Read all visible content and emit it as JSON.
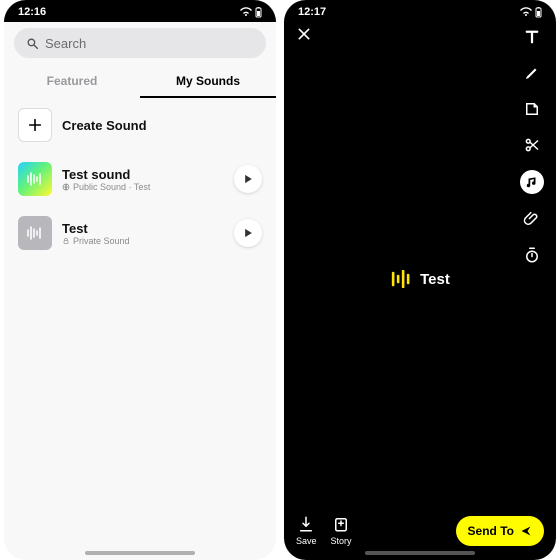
{
  "left": {
    "time": "12:16",
    "search_placeholder": "Search",
    "tabs": {
      "featured": "Featured",
      "my": "My Sounds"
    },
    "create": "Create Sound",
    "items": [
      {
        "title": "Test sound",
        "sub": "Public Sound · Test",
        "icon": "globe"
      },
      {
        "title": "Test",
        "sub": "Private Sound",
        "icon": "lock"
      }
    ]
  },
  "right": {
    "time": "12:17",
    "chip": "Test",
    "save": "Save",
    "story": "Story",
    "send": "Send To"
  }
}
